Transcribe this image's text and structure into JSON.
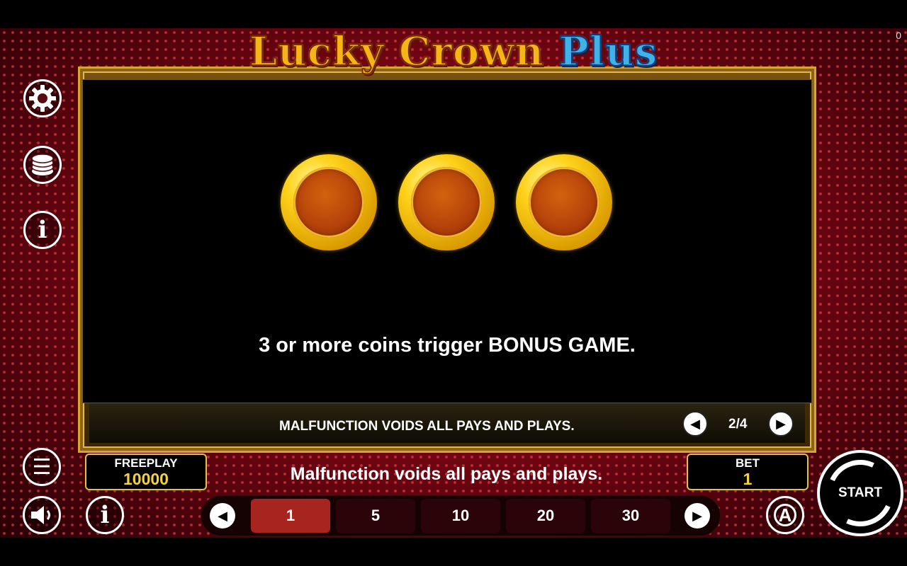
{
  "title": {
    "part1": "Lucky Crown",
    "part2": "Plus"
  },
  "corner_counter": "0",
  "paytable": {
    "description": "3 or more coins trigger BONUS GAME.",
    "coins": [
      "coin-symbol",
      "coin-symbol",
      "coin-symbol"
    ],
    "footer_notice": "MALFUNCTION VOIDS ALL PAYS AND PLAYS.",
    "page_indicator": "2/4",
    "prev_icon": "◀",
    "next_icon": "▶"
  },
  "sidebar": {
    "settings_icon": "gear-icon",
    "coins_icon": "coin-stack-icon",
    "info_icon": "info-icon",
    "info_glyph": "i"
  },
  "bottom": {
    "menu_glyph": "☰",
    "sound_glyph": "◀)",
    "info_glyph": "i",
    "auto_glyph": "A",
    "freeplay_label": "FREEPLAY",
    "freeplay_value": "10000",
    "notice": "Malfunction voids all pays and plays.",
    "bet_label": "BET",
    "bet_value": "1",
    "bet_options": [
      "1",
      "5",
      "10",
      "20",
      "30"
    ],
    "selected_bet": "1",
    "strip_prev_icon": "◀",
    "strip_next_icon": "▶",
    "start_label": "START"
  },
  "colors": {
    "background_red": "#8a0a14",
    "gold": "#e4c141",
    "active_bet": "#a8241e",
    "value_yellow": "#f3d33d"
  }
}
